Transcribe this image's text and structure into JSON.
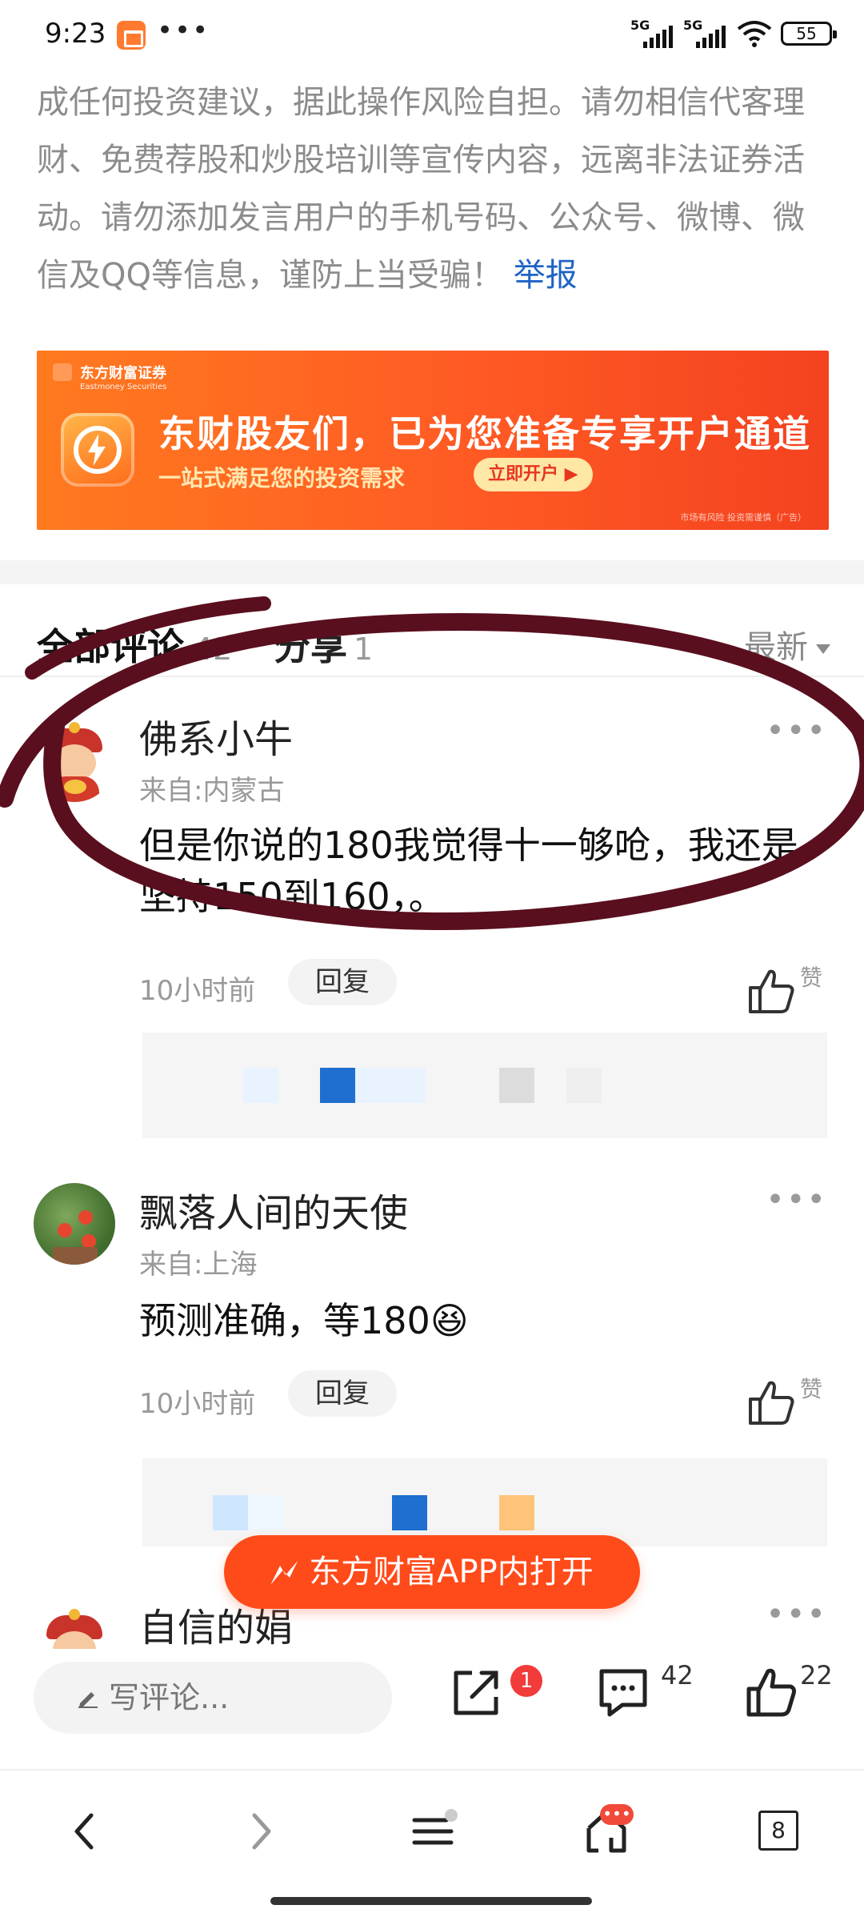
{
  "status_bar": {
    "time": "9:23",
    "network_1": "5G",
    "network_2": "5G",
    "battery": "55"
  },
  "disclaimer": {
    "text": "成任何投资建议，据此操作风险自担。请勿相信代客理财、免费荐股和炒股培训等宣传内容，远离非法证券活动。请勿添加发言用户的手机号码、公众号、微博、微信及QQ等信息，谨防上当受骗！",
    "report_link": "举报"
  },
  "banner": {
    "brand_cn": "东方财富证券",
    "brand_en": "Eastmoney Securities",
    "title": "东财股友们，已为您准备专享开户通道",
    "subtitle": "一站式满足您的投资需求",
    "cta": "立即开户 ▶",
    "note": "市场有风险 投资需谨慎（广告）"
  },
  "comments_header": {
    "title": "全部评论",
    "count": "42",
    "share_label": "分享",
    "share_count": "1",
    "sort": "最新"
  },
  "comments": [
    {
      "user": "佛系小牛",
      "location": "来自:内蒙古",
      "text": "但是你说的180我觉得十一够呛，我还是坚持150到160，。",
      "time": "10小时前",
      "reply": "回复",
      "like_label": "赞",
      "more": "•••"
    },
    {
      "user": "飘落人间的天使",
      "location": "来自:上海",
      "text": "预测准确，等180😆",
      "time": "10小时前",
      "reply": "回复",
      "like_label": "赞",
      "more": "•••"
    },
    {
      "user": "自信的娟",
      "more": "•••"
    }
  ],
  "app_button": "东方财富APP内打开",
  "action_bar": {
    "write_placeholder": "写评论...",
    "share_badge": "1",
    "comment_count": "42",
    "like_count": "22"
  },
  "browser_nav": {
    "tab_count": "8",
    "notify_dots": "•••"
  },
  "colors": {
    "accent_orange": "#ff4a1a",
    "link_blue": "#1f63c6",
    "annotation_ink": "#5a0f1e"
  },
  "icons": [
    "app-notification-icon",
    "wifi-icon",
    "pen-icon",
    "share-icon",
    "comment-icon",
    "thumbs-up-icon",
    "back-icon",
    "forward-icon",
    "menu-icon",
    "home-icon",
    "tabs-icon"
  ]
}
